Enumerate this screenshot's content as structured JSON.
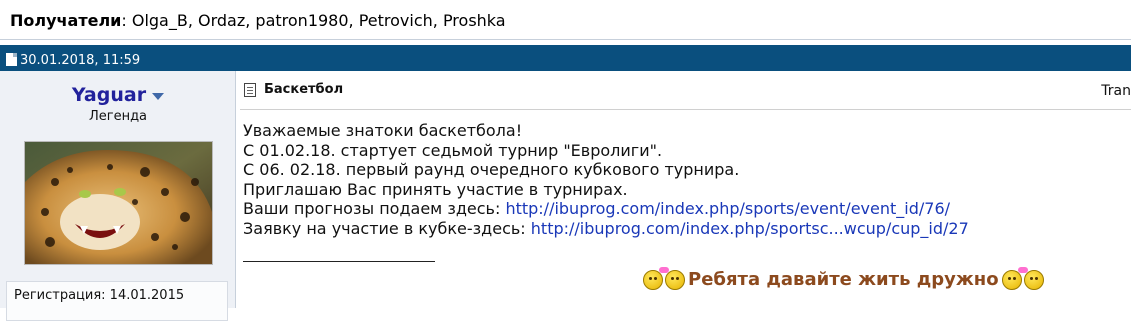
{
  "recipients": {
    "label": "Получатели",
    "list": ": Olga_B, Ordaz, patron1980, Petrovich, Proshka"
  },
  "post": {
    "datetime": "30.01.2018, 11:59"
  },
  "author": {
    "username": "Yaguar",
    "rank": "Легенда",
    "registration": "Регистрация: 14.01.2015"
  },
  "message": {
    "title": "Баскетбол",
    "translate_label": "Tran",
    "lines": [
      "Уважаемые знатоки баскетбола!",
      "С 01.02.18. стартует седьмой турнир \"Евролиги\".",
      "С 06. 02.18. первый раунд очередного кубкового турнира.",
      "Приглашаю Вас принять участие в турнирах."
    ],
    "forecast_prefix": "Ваши прогнозы подаем здесь: ",
    "forecast_link": "http://ibuprog.com/index.php/sports/event/event_id/76/",
    "cup_prefix": "Заявку на участие в кубке-здесь: ",
    "cup_link": "http://ibuprog.com/index.php/sportsc...wcup/cup_id/27",
    "signature": "Ребята давайте жить дружно"
  },
  "colors": {
    "header_bg": "#0a4f7e",
    "username": "#22229c",
    "link": "#1a38b8",
    "signature": "#8c4a1e",
    "sidebar_bg": "#eef1f6"
  }
}
